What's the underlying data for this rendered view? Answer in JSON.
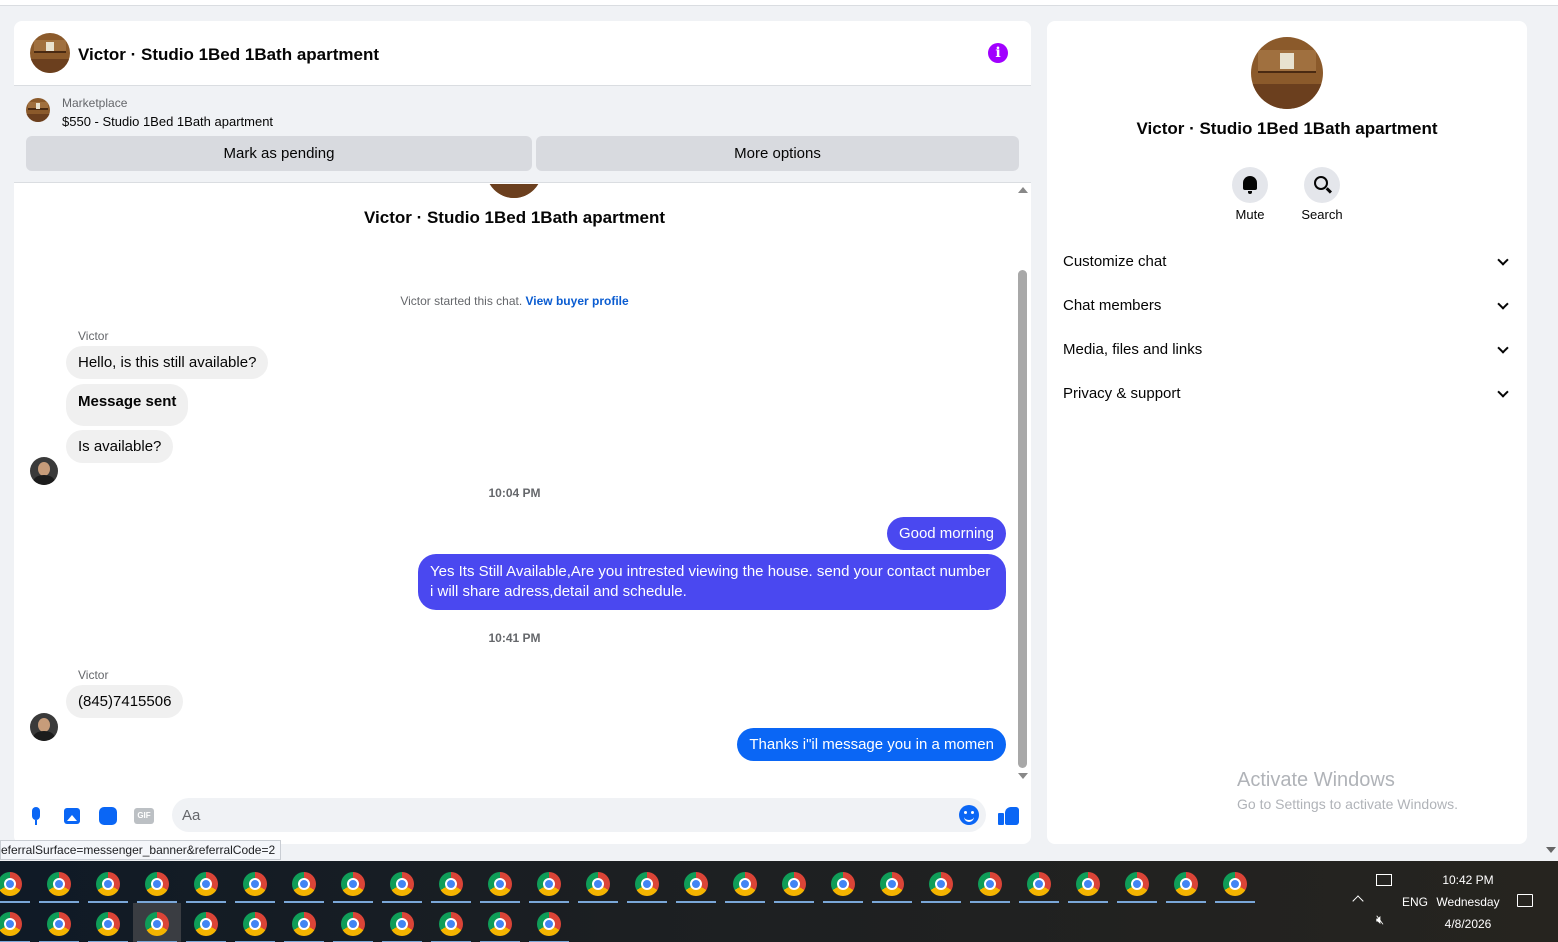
{
  "conversation": {
    "title": "Victor · Studio 1Bed 1Bath apartment",
    "info_icon": "info-icon"
  },
  "marketplace": {
    "label": "Marketplace",
    "listing": "$550 - Studio 1Bed 1Bath apartment",
    "mark_pending": "Mark as pending",
    "more_options": "More options"
  },
  "thread": {
    "title": "Victor · Studio 1Bed 1Bath apartment",
    "started_text": "Victor started this chat.",
    "view_profile": "View buyer profile",
    "sender1": "Victor",
    "msg1": "Hello, is this still available?",
    "msg2": "Message sent",
    "msg3": "Is available?",
    "time1": "10:04 PM",
    "out1": "Good morning",
    "out2": "Yes Its Still Available,Are you intrested viewing the house. send your contact number i will share adress,detail and schedule.",
    "time2": "10:41 PM",
    "sender2": "Victor",
    "msg4": "(845)7415506",
    "out3": "Thanks i\"il message you in a momen"
  },
  "composer": {
    "placeholder": "Aa",
    "icons": [
      "microphone-icon",
      "image-icon",
      "sticker-icon",
      "gif-icon",
      "emoji-icon",
      "like-icon"
    ]
  },
  "status_url": "eferralSurface=messenger_banner&referralCode=2",
  "details": {
    "title": "Victor · Studio 1Bed 1Bath apartment",
    "mute_label": "Mute",
    "search_label": "Search",
    "sections": [
      {
        "label": "Customize chat"
      },
      {
        "label": "Chat members"
      },
      {
        "label": "Media, files and links"
      },
      {
        "label": "Privacy & support"
      }
    ],
    "activate_title": "Activate Windows",
    "activate_sub": "Go to Settings to activate Windows."
  },
  "taskbar": {
    "language": "ENG",
    "time": "10:42 PM",
    "day": "Wednesday",
    "date": "4/8/2026",
    "row1_count": 26,
    "row2_count": 12,
    "active_index_row2": 3
  },
  "colors": {
    "accent_purple": "#a100ff",
    "outgoing_bubble": "#4a48f0",
    "outgoing_bubble_latest": "#0a66f5",
    "link_blue": "#0a5cd1"
  }
}
